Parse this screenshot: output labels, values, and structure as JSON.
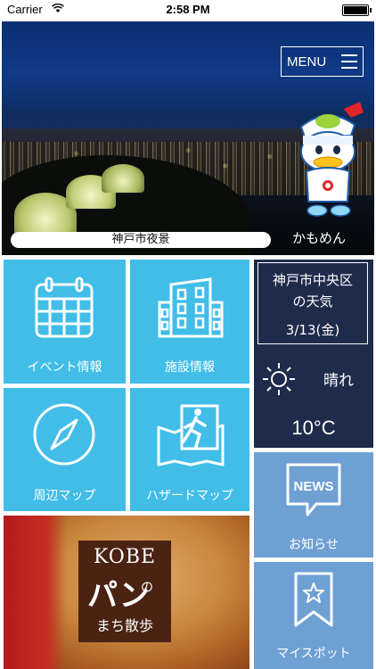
{
  "status_bar": {
    "carrier": "Carrier",
    "time": "2:58 PM"
  },
  "hero": {
    "menu_label": "MENU",
    "caption": "神戸市夜景",
    "mascot_name": "かもめん"
  },
  "tiles": {
    "events": "イベント情報",
    "facilities": "施設情報",
    "nearby_map": "周辺マップ",
    "hazard_map": "ハザードマップ"
  },
  "weather": {
    "line1": "神戸市中央区",
    "line2": "の天気",
    "date": "3/13(金)",
    "condition": "晴れ",
    "temperature": "10°C"
  },
  "nav": {
    "news_icon_text": "NEWS",
    "news": "お知らせ",
    "my_spot": "マイスポット"
  },
  "banner": {
    "line1": "KOBE",
    "line2": "パン",
    "line3": "の",
    "line4": "まち散歩"
  },
  "colors": {
    "tile": "#41bde8",
    "weather_bg": "#1f2b4b",
    "nav_tile": "#6fa0d3"
  }
}
